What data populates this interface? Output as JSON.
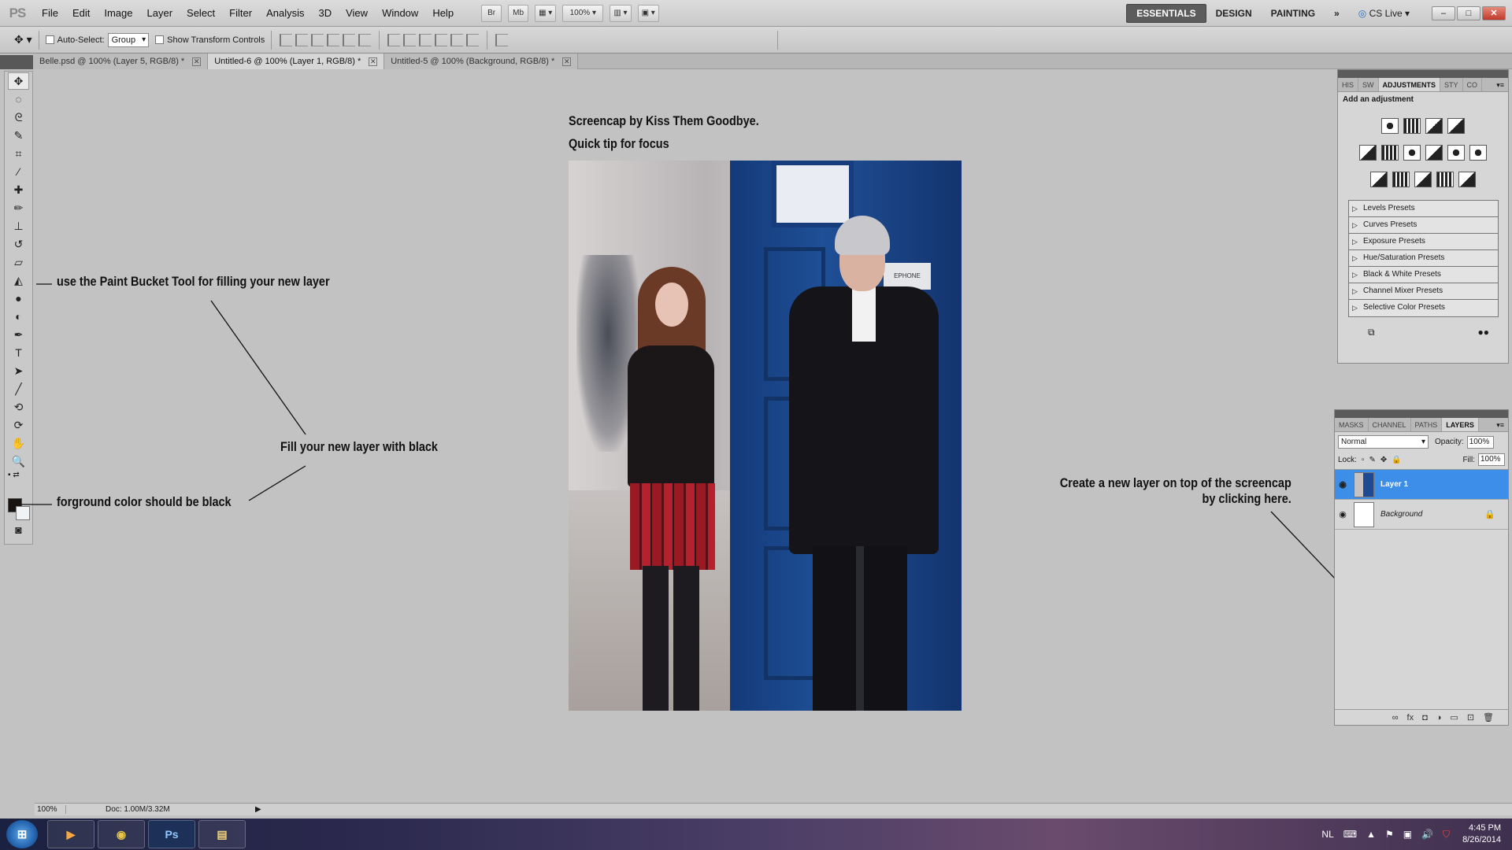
{
  "app": {
    "logo": "PS"
  },
  "menu": [
    "File",
    "Edit",
    "Image",
    "Layer",
    "Select",
    "Filter",
    "Analysis",
    "3D",
    "View",
    "Window",
    "Help"
  ],
  "menubar": {
    "bridge": "Br",
    "minibridge": "Mb",
    "zoom": "100%",
    "workspaces": [
      "ESSENTIALS",
      "DESIGN",
      "PAINTING"
    ],
    "more": "»",
    "cslive": "CS Live",
    "win_min": "–",
    "win_max": "□",
    "win_close": "✕"
  },
  "options": {
    "auto_select_label": "Auto-Select:",
    "auto_select_value": "Group",
    "show_transform_label": "Show Transform Controls"
  },
  "doc_tabs": [
    {
      "label": "Belle.psd @ 100% (Layer 5, RGB/8) *"
    },
    {
      "label": "Untitled-6 @ 100% (Layer 1, RGB/8) *"
    },
    {
      "label": "Untitled-5 @ 100% (Background, RGB/8) *"
    }
  ],
  "tools": [
    "move-icon",
    "marquee-icon",
    "lasso-icon",
    "quick-select-icon",
    "crop-icon",
    "eyedropper-icon",
    "healing-icon",
    "brush-icon",
    "stamp-icon",
    "history-brush-icon",
    "eraser-icon",
    "paint-bucket-icon",
    "blur-icon",
    "dodge-icon",
    "pen-icon",
    "type-icon",
    "path-select-icon",
    "line-icon",
    "3d-rotate-icon",
    "3d-orbit-icon",
    "hand-icon",
    "zoom-icon"
  ],
  "colors": {
    "foreground": "#1a1411",
    "background": "#f0f3f6",
    "accent": "#3d8ee8"
  },
  "canvas": {
    "caption_line1": "Screencap by Kiss Them Goodbye.",
    "caption_line2": "Quick tip for focus",
    "photo_sign": "EPHONE"
  },
  "annotations": {
    "paint_bucket": "use the Paint Bucket Tool for filling your new layer",
    "fill_black": "Fill your new layer with black",
    "foreground_black": "forground color should be black",
    "new_layer_line1": "Create a new layer on top of the screencap",
    "new_layer_line2": "by clicking here."
  },
  "status": {
    "zoom": "100%",
    "doc": "Doc: 1.00M/3.32M"
  },
  "adjustments_panel": {
    "tabs": [
      "HIS",
      "SW",
      "ADJUSTMENTS",
      "STY",
      "CO"
    ],
    "title": "Add an adjustment",
    "presets": [
      "Levels Presets",
      "Curves Presets",
      "Exposure Presets",
      "Hue/Saturation Presets",
      "Black & White Presets",
      "Channel Mixer Presets",
      "Selective Color Presets"
    ]
  },
  "layers_panel": {
    "tabs": [
      "MASKS",
      "CHANNEL",
      "PATHS",
      "LAYERS"
    ],
    "blend_mode": "Normal",
    "opacity_label": "Opacity:",
    "opacity_value": "100%",
    "lock_label": "Lock:",
    "fill_label": "Fill:",
    "fill_value": "100%",
    "layers": [
      {
        "name": "Layer 1"
      },
      {
        "name": "Background"
      }
    ],
    "footer_icons": [
      "link-icon",
      "fx-icon",
      "mask-icon",
      "adjustment-icon",
      "group-icon",
      "new-layer-icon",
      "trash-icon"
    ]
  },
  "taskbar": {
    "start": "⊞",
    "apps": [
      "▶",
      "◉",
      "Ps",
      "▤"
    ],
    "lang": "NL",
    "time": "4:45 PM",
    "date": "8/26/2014"
  }
}
